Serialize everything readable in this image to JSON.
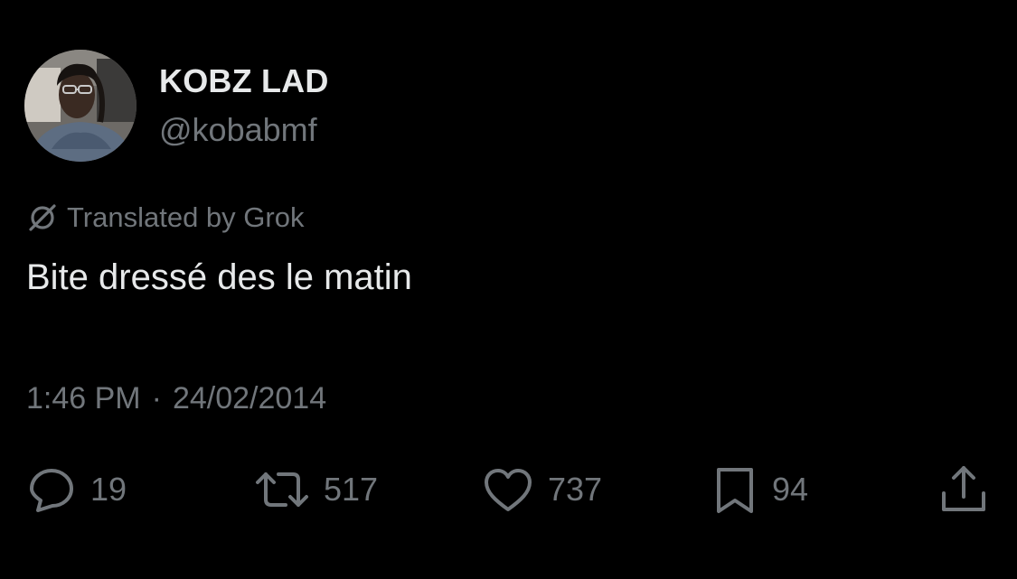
{
  "author": {
    "display_name": "KOBZ LAD",
    "handle": "@kobabmf"
  },
  "translation": {
    "label": "Translated by Grok",
    "icon": "grok-icon"
  },
  "tweet": {
    "text": "Bite dressé des le matin"
  },
  "meta": {
    "time": "1:46 PM",
    "separator": "·",
    "date": "24/02/2014"
  },
  "actions": {
    "replies": "19",
    "retweets": "517",
    "likes": "737",
    "bookmarks": "94"
  },
  "colors": {
    "background": "#000000",
    "primary_text": "#e7e9ea",
    "secondary_text": "#71767b"
  }
}
